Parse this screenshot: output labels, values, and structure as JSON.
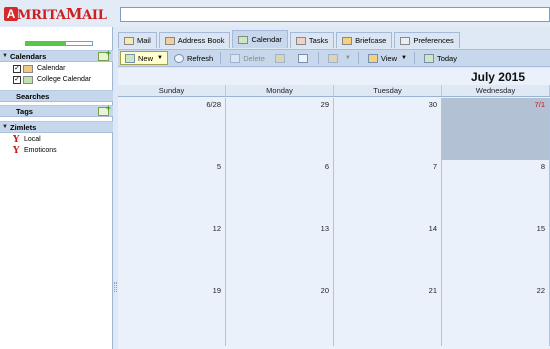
{
  "app": {
    "logo_initial": "A",
    "logo_text_1": "MRITA",
    "logo_text_2": "M",
    "logo_text_3": "AIL",
    "quota_fraction": 0.6
  },
  "sidebar": {
    "calendars_header": "Calendars",
    "calendars": [
      {
        "label": "Calendar",
        "checked": true,
        "color": "#f0c785"
      },
      {
        "label": "College Calendar",
        "checked": true,
        "color": "#bfe3b0"
      }
    ],
    "searches_header": "Searches",
    "tags_header": "Tags",
    "zimlets_header": "Zimlets",
    "zimlets": [
      {
        "label": "Local",
        "icon": "yahoo-y-icon"
      },
      {
        "label": "Emoticons",
        "icon": "yahoo-y-icon"
      }
    ]
  },
  "tabs": [
    {
      "label": "Mail",
      "icon": "mail-icon",
      "active": false
    },
    {
      "label": "Address Book",
      "icon": "address-book-icon",
      "active": false
    },
    {
      "label": "Calendar",
      "icon": "calendar-icon",
      "active": true
    },
    {
      "label": "Tasks",
      "icon": "tasks-icon",
      "active": false
    },
    {
      "label": "Briefcase",
      "icon": "briefcase-icon",
      "active": false
    },
    {
      "label": "Preferences",
      "icon": "preferences-icon",
      "active": false
    }
  ],
  "toolbar": {
    "new_label": "New",
    "refresh_label": "Refresh",
    "delete_label": "Delete",
    "view_label": "View",
    "today_label": "Today"
  },
  "calendar": {
    "month_title": "July 2015",
    "weekdays": [
      "Sunday",
      "Monday",
      "Tuesday",
      "Wednesday"
    ],
    "weeks": [
      [
        "6/28",
        "29",
        "30",
        "7/1"
      ],
      [
        "5",
        "6",
        "7",
        "8"
      ],
      [
        "12",
        "13",
        "14",
        "15"
      ],
      [
        "19",
        "20",
        "21",
        "22"
      ]
    ],
    "today_label": "7/1"
  }
}
